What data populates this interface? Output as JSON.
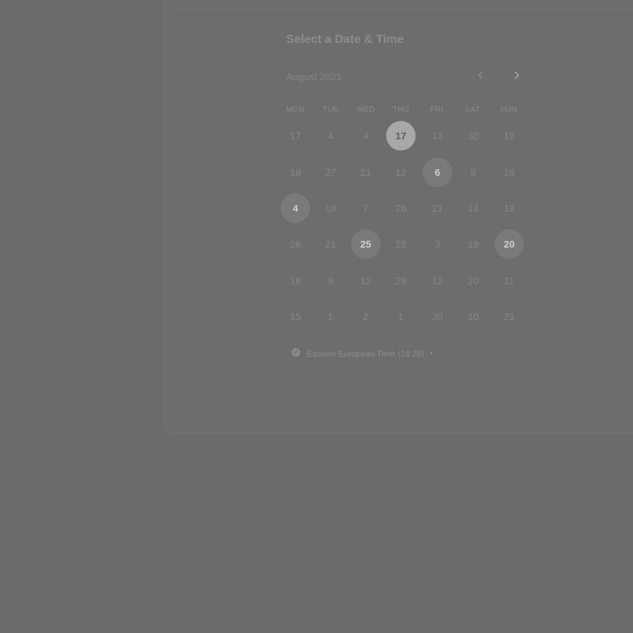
{
  "scheduler": {
    "title": "Select a Date & Time",
    "month_label": "August 2021",
    "prev_icon": "chevron-left-icon",
    "next_icon": "chevron-right-icon",
    "weekdays": [
      "MON",
      "TUE",
      "WED",
      "THU",
      "FRI",
      "SAT",
      "SUN"
    ],
    "weeks": [
      [
        "17",
        "4",
        "4",
        "17",
        "13",
        "30",
        "18"
      ],
      [
        "18",
        "27",
        "21",
        "12",
        "6",
        "8",
        "16"
      ],
      [
        "4",
        "18",
        "7",
        "26",
        "21",
        "14",
        "18"
      ],
      [
        "26",
        "21",
        "25",
        "23",
        "3",
        "19",
        "20"
      ],
      [
        "18",
        "9",
        "12",
        "29",
        "12",
        "20",
        "11"
      ],
      [
        "15",
        "1",
        "2",
        "1",
        "30",
        "10",
        "21"
      ]
    ],
    "selected_day": "17",
    "available_days": [
      "6",
      "4",
      "25",
      "20"
    ],
    "timezone": {
      "icon": "globe-icon",
      "label": "Eastern European Time (16:28)",
      "caret": "▾"
    }
  },
  "colors": {
    "page_bg": "#6b6b6b",
    "selected_bg": "#a8a8a8",
    "available_bg": "#7a7a7a"
  }
}
